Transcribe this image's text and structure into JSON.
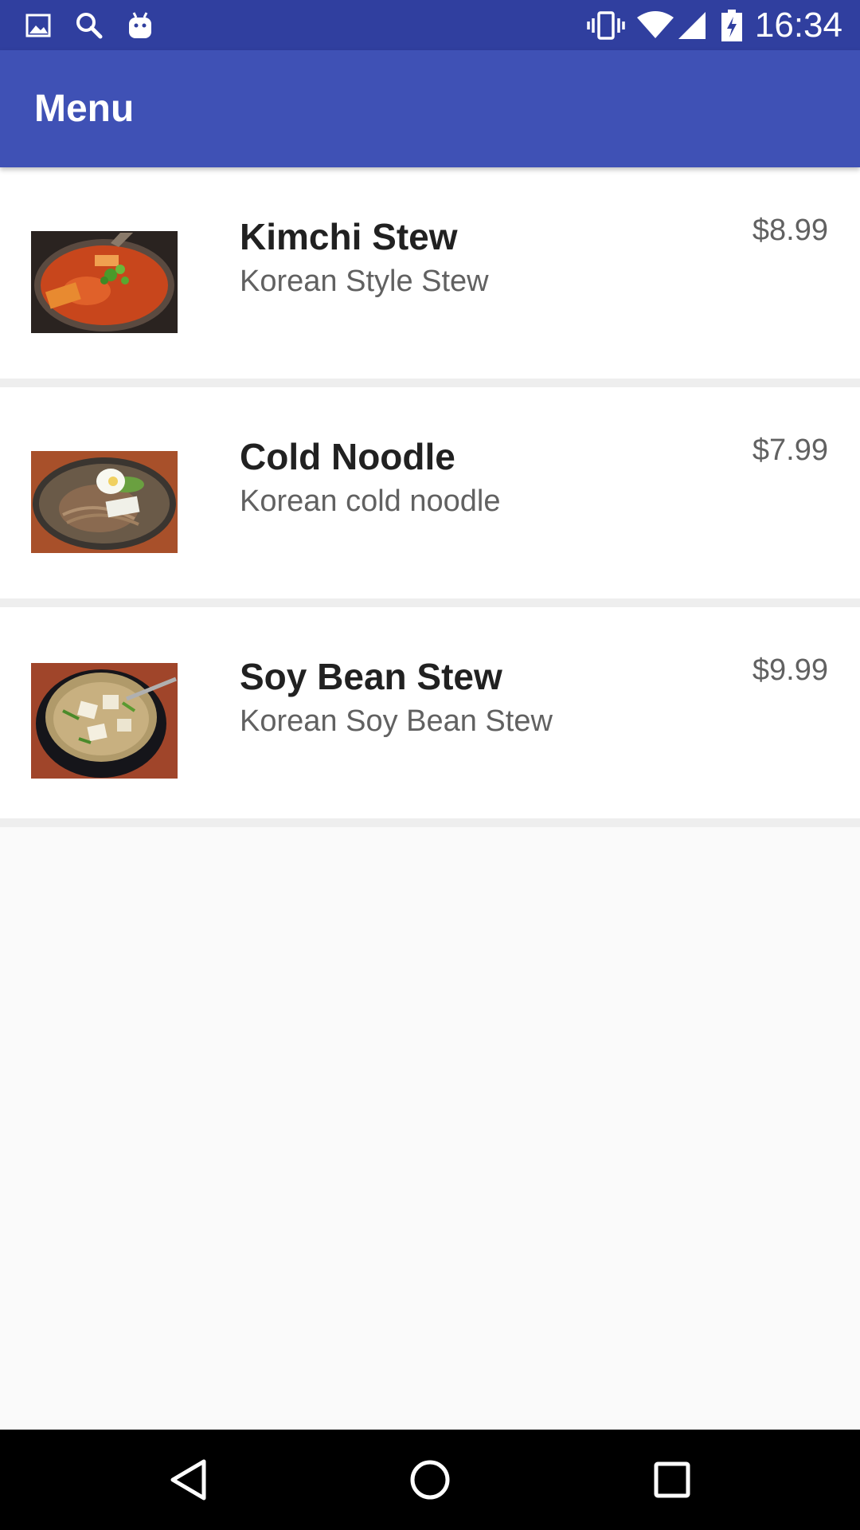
{
  "status_bar": {
    "time": "16:34",
    "left_icons": [
      "image-icon",
      "search-icon",
      "android-icon"
    ],
    "right_icons": [
      "vibrate-icon",
      "wifi-icon",
      "signal-icon",
      "battery-charging-icon"
    ]
  },
  "app_bar": {
    "title": "Menu",
    "color": "#3f51b5"
  },
  "menu": {
    "items": [
      {
        "name": "Kimchi Stew",
        "description": "Korean Style Stew",
        "price": "$8.99",
        "image": "kimchi-stew-photo"
      },
      {
        "name": "Cold Noodle",
        "description": "Korean cold noodle",
        "price": "$7.99",
        "image": "cold-noodle-photo"
      },
      {
        "name": "Soy Bean Stew",
        "description": "Korean Soy Bean Stew",
        "price": "$9.99",
        "image": "soy-bean-stew-photo"
      }
    ]
  },
  "nav_bar": {
    "buttons": [
      "back-icon",
      "home-icon",
      "recents-icon"
    ]
  }
}
